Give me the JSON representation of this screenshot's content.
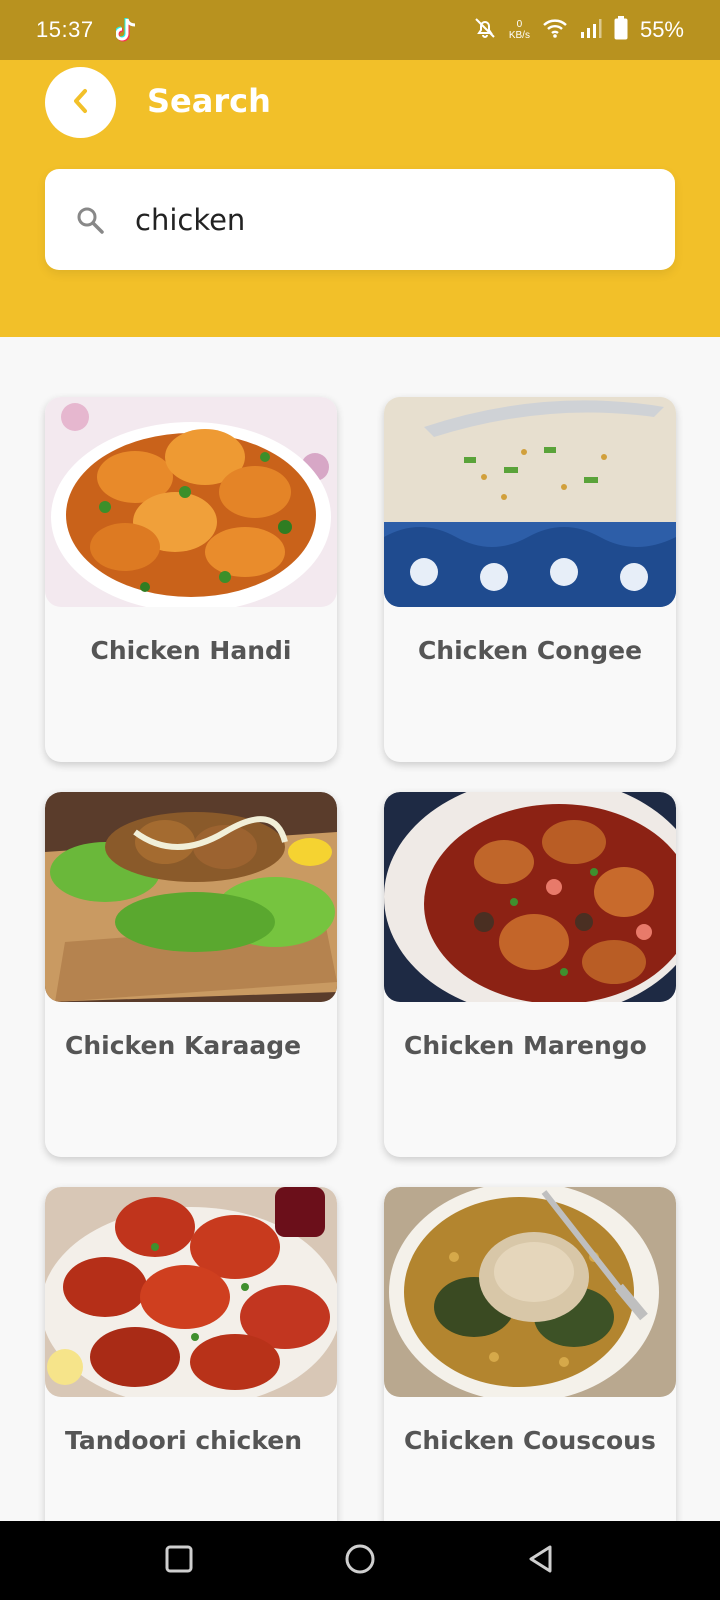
{
  "status_bar": {
    "time": "15:37",
    "net_speed_value": "0",
    "net_speed_unit": "KB/s",
    "battery": "55%"
  },
  "header": {
    "title": "Search",
    "back_icon": "chevron-left-icon"
  },
  "search": {
    "value": "chicken",
    "placeholder": "",
    "icon": "search-icon"
  },
  "results": [
    {
      "title": "Chicken Handi",
      "image": "curry-chicken-photo"
    },
    {
      "title": "Chicken Congee",
      "image": "congee-bowl-photo"
    },
    {
      "title": "Chicken Karaage",
      "image": "karaage-lettuce-photo"
    },
    {
      "title": "Chicken Marengo",
      "image": "marengo-pot-photo"
    },
    {
      "title": "Tandoori chicken",
      "image": "tandoori-platter-photo"
    },
    {
      "title": "Chicken Couscous",
      "image": "couscous-plate-photo"
    }
  ],
  "colors": {
    "status_bar": "#b8921f",
    "header": "#f2c029",
    "accent": "#f2c029",
    "card_title": "#555555"
  },
  "nav_bar": {
    "icons": [
      "square-recents-icon",
      "circle-home-icon",
      "triangle-back-icon"
    ]
  }
}
